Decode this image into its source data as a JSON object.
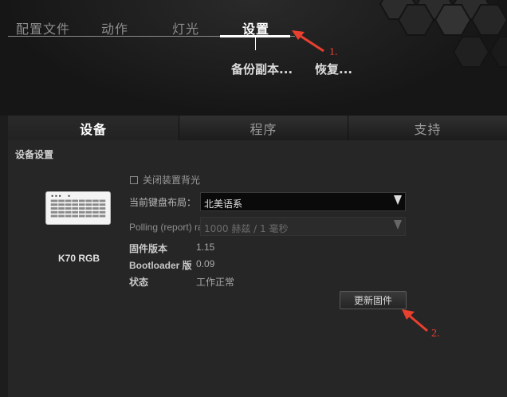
{
  "top_nav": {
    "items": [
      {
        "label": "配置文件"
      },
      {
        "label": "动作"
      },
      {
        "label": "灯光"
      },
      {
        "label": "设置"
      }
    ],
    "active_index": 3
  },
  "sub_actions": {
    "backup": "备份副本...",
    "restore": "恢复..."
  },
  "annotations": {
    "one": "1.",
    "two": "2."
  },
  "tabs": [
    {
      "label": "设备"
    },
    {
      "label": "程序"
    },
    {
      "label": "支持"
    }
  ],
  "device_settings": {
    "section_title": "设备设置",
    "device_name": "K70 RGB",
    "disable_backlight_label": "关闭装置背光",
    "layout_label": "当前键盘布局：",
    "layout_value": "北美语系",
    "polling_label": "Polling (report) rate:",
    "polling_value": "1000 赫兹 / 1 毫秒",
    "firmware_label": "固件版本",
    "firmware_value": "1.15",
    "bootloader_label": "Bootloader 版",
    "bootloader_value": "0.09",
    "status_label": "状态",
    "status_value": "工作正常",
    "update_button": "更新固件"
  },
  "colors": {
    "accent_arrow": "#e8402f",
    "active_text": "#ffffff",
    "background": "#1d1d1d"
  }
}
